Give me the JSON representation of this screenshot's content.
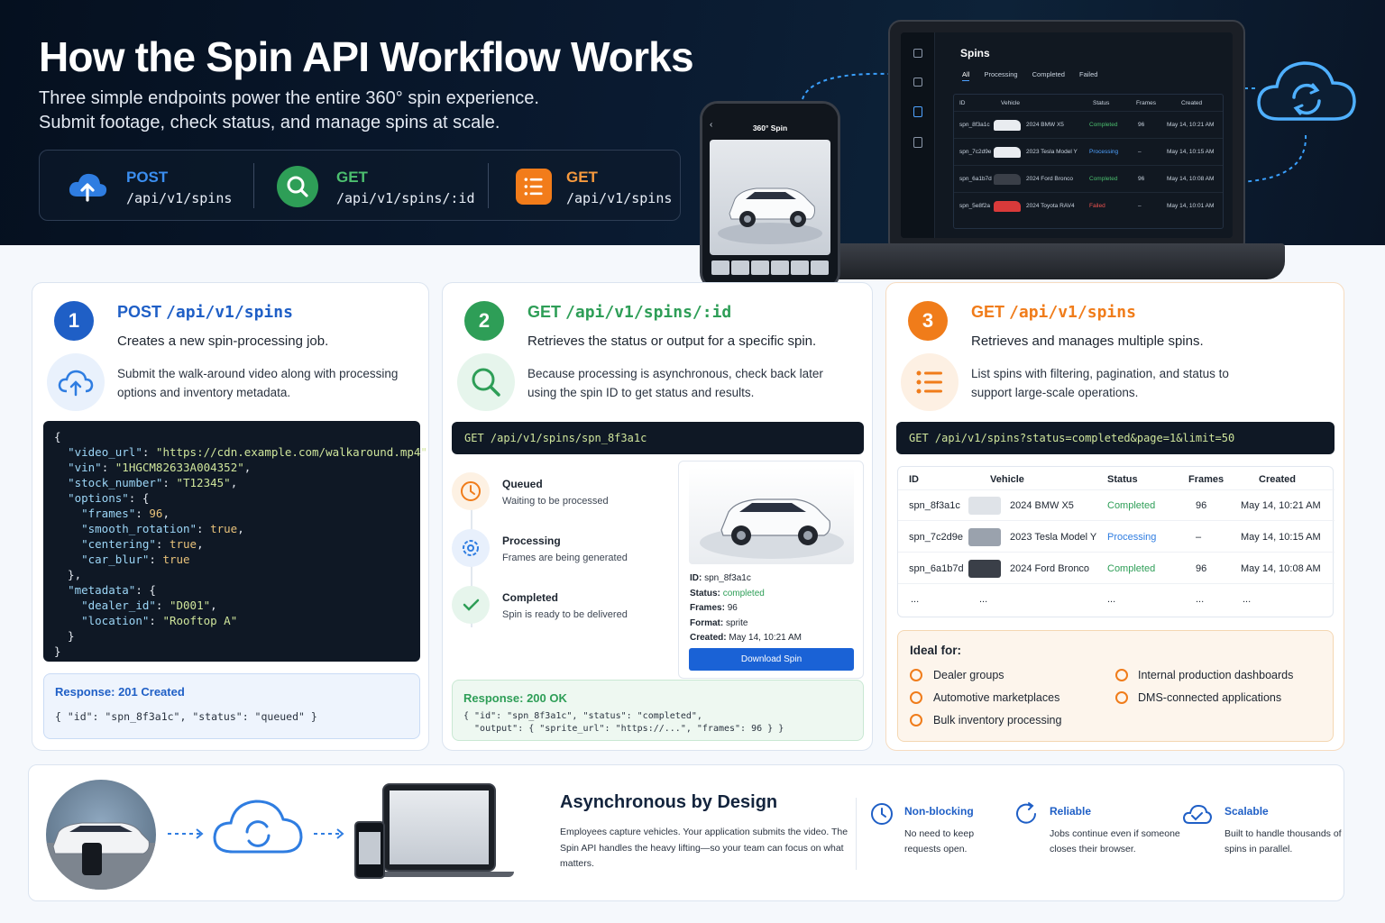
{
  "hero": {
    "title": "How the Spin API Workflow Works",
    "subtitle_line1": "Three simple endpoints power the entire 360° spin experience.",
    "subtitle_line2": "Submit footage, check status, and manage spins at scale."
  },
  "endpoints": [
    {
      "method": "POST",
      "path": "/api/v1/spins",
      "icon": "cloud-upload-icon",
      "color": "#2f7de1"
    },
    {
      "method": "GET",
      "path": "/api/v1/spins/:id",
      "icon": "search-icon",
      "color": "#2e9e57"
    },
    {
      "method": "GET",
      "path": "/api/v1/spins",
      "icon": "list-icon",
      "color": "#f27c1a"
    }
  ],
  "laptop": {
    "title": "Spins",
    "tabs": [
      "All",
      "Processing",
      "Completed",
      "Failed"
    ],
    "headers": [
      "ID",
      "Vehicle",
      "Status",
      "Frames",
      "Created"
    ],
    "rows": [
      {
        "id": "spn_8f3a1c",
        "vehicle": "2024 BMW X5",
        "status": "Completed",
        "frames": "96",
        "created": "May 14, 10:21 AM"
      },
      {
        "id": "spn_7c2d9e",
        "vehicle": "2023 Tesla Model Y",
        "status": "Processing",
        "frames": "–",
        "created": "May 14, 10:15 AM"
      },
      {
        "id": "spn_6a1b7d",
        "vehicle": "2024 Ford Bronco",
        "status": "Completed",
        "frames": "96",
        "created": "May 14, 10:08 AM"
      },
      {
        "id": "spn_5e8f2a",
        "vehicle": "2024 Toyota RAV4",
        "status": "Failed",
        "frames": "–",
        "created": "May 14, 10:01 AM"
      }
    ]
  },
  "phone": {
    "title": "360° Spin"
  },
  "card1": {
    "num": "1",
    "method": "POST",
    "path": "/api/v1/spins",
    "line1": "Creates a new spin-processing job.",
    "line2": "Submit the walk-around video along with processing options and inventory metadata.",
    "code": {
      "video_url": "\"https://cdn.example.com/walkaround.mp4\"",
      "vin": "\"1HGCM82633A004352\"",
      "stock_number": "\"T12345\"",
      "frames": "96",
      "smooth_rotation": "true",
      "centering": "true",
      "car_blur": "true",
      "dealer_id": "\"D001\"",
      "location": "\"Rooftop A\""
    },
    "response_label": "Response: 201 Created",
    "response_body": "{ \"id\": \"spn_8f3a1c\", \"status\": \"queued\" }"
  },
  "card2": {
    "num": "2",
    "method": "GET",
    "path": "/api/v1/spins/:id",
    "line1": "Retrieves the status or output for a specific spin.",
    "line2": "Because processing is asynchronous, check back later using the spin ID to get status and results.",
    "request": "GET /api/v1/spins/spn_8f3a1c",
    "timeline": [
      {
        "title": "Queued",
        "desc": "Waiting to be processed"
      },
      {
        "title": "Processing",
        "desc": "Frames are being generated"
      },
      {
        "title": "Completed",
        "desc": "Spin is ready to be delivered"
      }
    ],
    "detail": {
      "id_label": "ID:",
      "id": "spn_8f3a1c",
      "status_label": "Status:",
      "status": "completed",
      "frames_label": "Frames:",
      "frames": "96",
      "format_label": "Format:",
      "format": "sprite",
      "created_label": "Created:",
      "created": "May 14, 10:21 AM",
      "button": "Download Spin"
    },
    "response_label": "Response: 200 OK",
    "response_body": "{ \"id\": \"spn_8f3a1c\", \"status\": \"completed\",\n  \"output\": { \"sprite_url\": \"https://...\", \"frames\": 96 } }"
  },
  "card3": {
    "num": "3",
    "method": "GET",
    "path": "/api/v1/spins",
    "line1": "Retrieves and manages multiple spins.",
    "line2": "List spins with filtering, pagination, and status to support large-scale operations.",
    "request": "GET /api/v1/spins?status=completed&page=1&limit=50",
    "headers": [
      "ID",
      "Vehicle",
      "Status",
      "Frames",
      "Created"
    ],
    "rows": [
      {
        "id": "spn_8f3a1c",
        "vehicle": "2024 BMW X5",
        "status": "Completed",
        "frames": "96",
        "created": "May 14, 10:21 AM"
      },
      {
        "id": "spn_7c2d9e",
        "vehicle": "2023 Tesla Model Y",
        "status": "Processing",
        "frames": "–",
        "created": "May 14, 10:15 AM"
      },
      {
        "id": "spn_6a1b7d",
        "vehicle": "2024 Ford Bronco",
        "status": "Completed",
        "frames": "96",
        "created": "May 14, 10:08 AM"
      }
    ],
    "ellipsis": "...",
    "ideal_title": "Ideal for:",
    "ideal": [
      "Dealer groups",
      "Automotive marketplaces",
      "Bulk inventory processing",
      "Internal production dashboards",
      "DMS-connected applications"
    ]
  },
  "bottom": {
    "title": "Asynchronous by Design",
    "desc": "Employees capture vehicles. Your application submits the video. The Spin API handles the heavy lifting—so your team can focus on what matters.",
    "features": [
      {
        "title": "Non-blocking",
        "desc": "No need to keep requests open.",
        "icon": "clock-icon"
      },
      {
        "title": "Reliable",
        "desc": "Jobs continue even if someone closes their browser.",
        "icon": "refresh-icon"
      },
      {
        "title": "Scalable",
        "desc": "Built to handle thousands of spins in parallel.",
        "icon": "cloud-check-icon"
      }
    ]
  },
  "colors": {
    "blue": "#1f5fc6",
    "green": "#2e9e57",
    "orange": "#f07c1a",
    "dark": "#0f1825"
  }
}
